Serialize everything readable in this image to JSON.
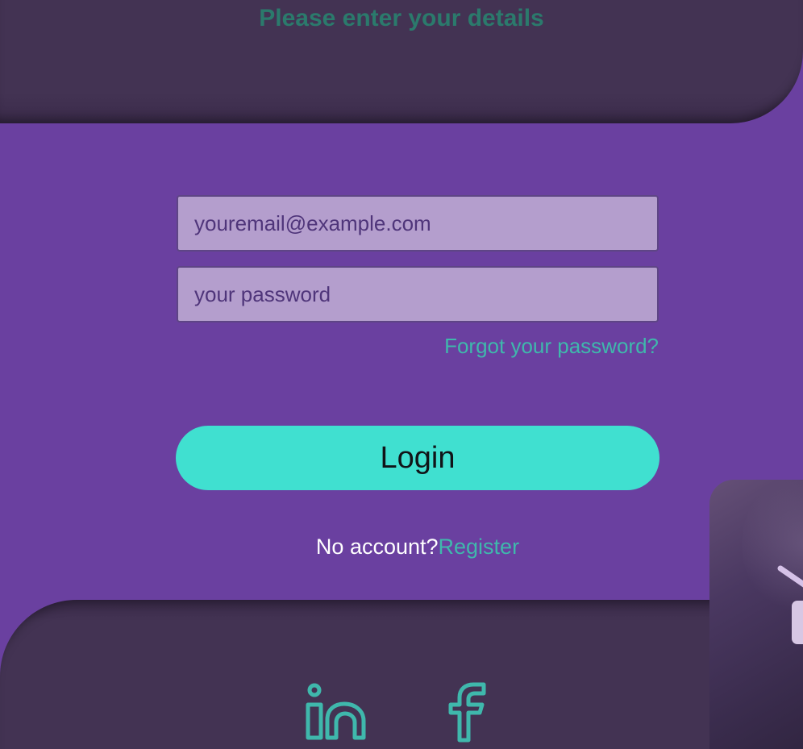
{
  "header": {
    "subtitle": "Please enter your details"
  },
  "form": {
    "email_placeholder": "youremail@example.com",
    "password_placeholder": "your password",
    "forgot_label": "Forgot your password?",
    "login_label": "Login",
    "no_account_label": "No account?",
    "register_label": "Register"
  },
  "footer": {
    "social": [
      {
        "icon": "linkedin-icon"
      },
      {
        "icon": "facebook-icon"
      }
    ]
  },
  "colors": {
    "background": "#6a40a0",
    "panel": "#433353",
    "accent": "#40e0d0",
    "link": "#3fb8ac",
    "subtitle": "#2b7a6c",
    "input_bg": "#b49ecd"
  }
}
